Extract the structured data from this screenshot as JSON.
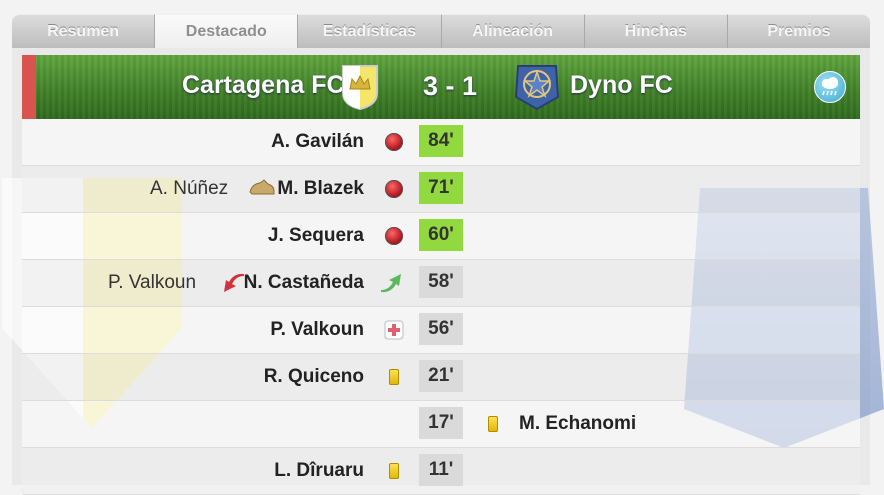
{
  "tabs": [
    "Resumen",
    "Destacado",
    "Estadísticas",
    "Alineación",
    "Hinchas",
    "Premios"
  ],
  "active_tab": "Destacado",
  "match": {
    "home": "Cartagena FC",
    "away": "Dyno FC",
    "score": "3 - 1",
    "weather_icon": "rain-cloud-icon"
  },
  "events": [
    {
      "side": "home",
      "player": "A. Gavilán",
      "minute": "84'",
      "type": "goal",
      "assist": ""
    },
    {
      "side": "home",
      "player": "M. Blazek",
      "minute": "71'",
      "type": "goal",
      "assist": "A. Núñez"
    },
    {
      "side": "home",
      "player": "J. Sequera",
      "minute": "60'",
      "type": "goal",
      "assist": ""
    },
    {
      "side": "home",
      "player": "N. Castañeda",
      "minute": "58'",
      "type": "substitution",
      "assist": "P. Valkoun"
    },
    {
      "side": "home",
      "player": "P. Valkoun",
      "minute": "56'",
      "type": "injury",
      "assist": ""
    },
    {
      "side": "home",
      "player": "R. Quiceno",
      "minute": "21'",
      "type": "yellow-card",
      "assist": ""
    },
    {
      "side": "away",
      "player": "M. Echanomi",
      "minute": "17'",
      "type": "yellow-card",
      "assist": ""
    },
    {
      "side": "home",
      "player": "L. Dîruaru",
      "minute": "11'",
      "type": "yellow-card",
      "assist": ""
    }
  ],
  "colors": {
    "goal_minute": "#92d83f",
    "header_green": "#4a8c2f",
    "accent_red": "#d9534f"
  }
}
